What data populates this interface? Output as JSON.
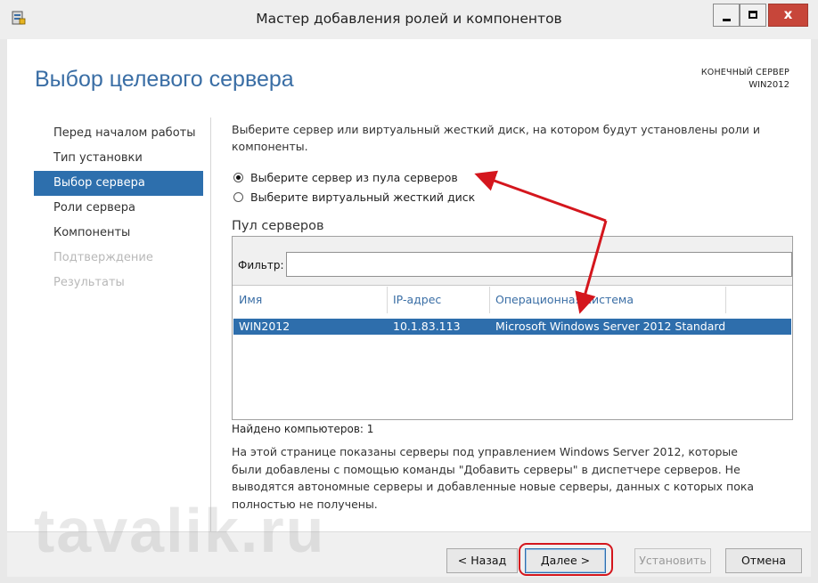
{
  "window": {
    "title": "Мастер добавления ролей и компонентов",
    "controls": [
      "minimize",
      "maximize",
      "close"
    ]
  },
  "header": {
    "page_title": "Выбор целевого сервера",
    "destination_label": "КОНЕЧНЫЙ СЕРВЕР",
    "destination_server": "WIN2012"
  },
  "nav": {
    "items": [
      {
        "label": "Перед началом работы",
        "state": "normal"
      },
      {
        "label": "Тип установки",
        "state": "normal"
      },
      {
        "label": "Выбор сервера",
        "state": "active"
      },
      {
        "label": "Роли сервера",
        "state": "normal"
      },
      {
        "label": "Компоненты",
        "state": "normal"
      },
      {
        "label": "Подтверждение",
        "state": "disabled"
      },
      {
        "label": "Результаты",
        "state": "disabled"
      }
    ]
  },
  "main": {
    "description": "Выберите сервер или виртуальный жесткий диск, на котором будут установлены роли и компоненты.",
    "radio_pool": "Выберите сервер из пула серверов",
    "radio_vhd": "Выберите виртуальный жесткий диск",
    "selected_option": "pool",
    "pool_title": "Пул серверов",
    "filter_label": "Фильтр:",
    "filter_value": "",
    "columns": [
      "Имя",
      "IP-адрес",
      "Операционная система"
    ],
    "rows": [
      {
        "name": "WIN2012",
        "ip": "10.1.83.113",
        "os": "Microsoft Windows Server 2012 Standard",
        "selected": true
      }
    ],
    "found": "Найдено компьютеров: 1",
    "info": "На этой странице показаны серверы под управлением Windows Server 2012, которые были добавлены с помощью команды \"Добавить серверы\" в диспетчере серверов. Не выводятся автономные серверы и добавленные новые серверы, данных с которых пока полностью не получены."
  },
  "footer": {
    "back_label": "< Назад",
    "next_label": "Далее >",
    "install_label": "Установить",
    "cancel_label": "Отмена",
    "watermark": "tavalik.ru"
  },
  "colors": {
    "accent": "#2e6eac",
    "heading": "#3a6ea5",
    "annotation": "#d4161d",
    "close_button": "#c7463a"
  }
}
